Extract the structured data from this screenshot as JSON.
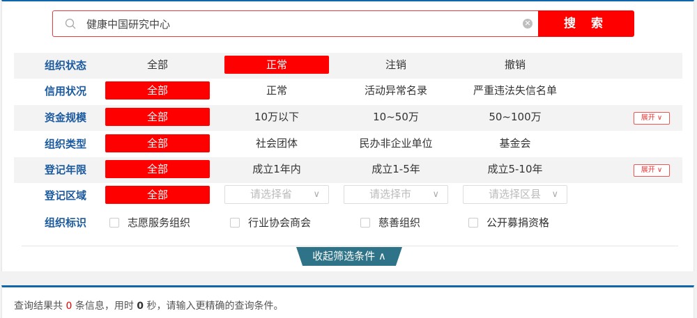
{
  "search": {
    "value": "健康中国研究中心",
    "button_label": "搜 索"
  },
  "filters": {
    "status": {
      "label": "组织状态",
      "options": [
        "全部",
        "正常",
        "注销",
        "撤销"
      ],
      "selected": "正常"
    },
    "credit": {
      "label": "信用状况",
      "options": [
        "全部",
        "正常",
        "活动异常名录",
        "严重违法失信名单"
      ],
      "selected": "全部"
    },
    "funds": {
      "label": "资金规模",
      "options": [
        "全部",
        "10万以下",
        "10~50万",
        "50~100万"
      ],
      "selected": "全部",
      "expand_label": "展开"
    },
    "type": {
      "label": "组织类型",
      "options": [
        "全部",
        "社会团体",
        "民办非企业单位",
        "基金会"
      ],
      "selected": "全部"
    },
    "years": {
      "label": "登记年限",
      "options": [
        "全部",
        "成立1年内",
        "成立1-5年",
        "成立5-10年"
      ],
      "selected": "全部",
      "expand_label": "展开"
    },
    "region": {
      "label": "登记区域",
      "all": "全部",
      "province_placeholder": "请选择省",
      "city_placeholder": "请选择市",
      "district_placeholder": "请选择区县"
    },
    "tags": {
      "label": "组织标识",
      "options": [
        "志愿服务组织",
        "行业协会商会",
        "慈善组织",
        "公开募捐资格"
      ]
    }
  },
  "collapse_label": "收起筛选条件",
  "result": {
    "prefix": "查询结果共",
    "count": "0",
    "mid1": "条信息，用时",
    "time": "0",
    "suffix": "秒，请输入更精确的查询条件。"
  },
  "colors": {
    "accent": "#ff0000",
    "label_blue": "#1b5a9e",
    "tab_teal": "#2f7388",
    "border_blue": "#0f66aa"
  }
}
